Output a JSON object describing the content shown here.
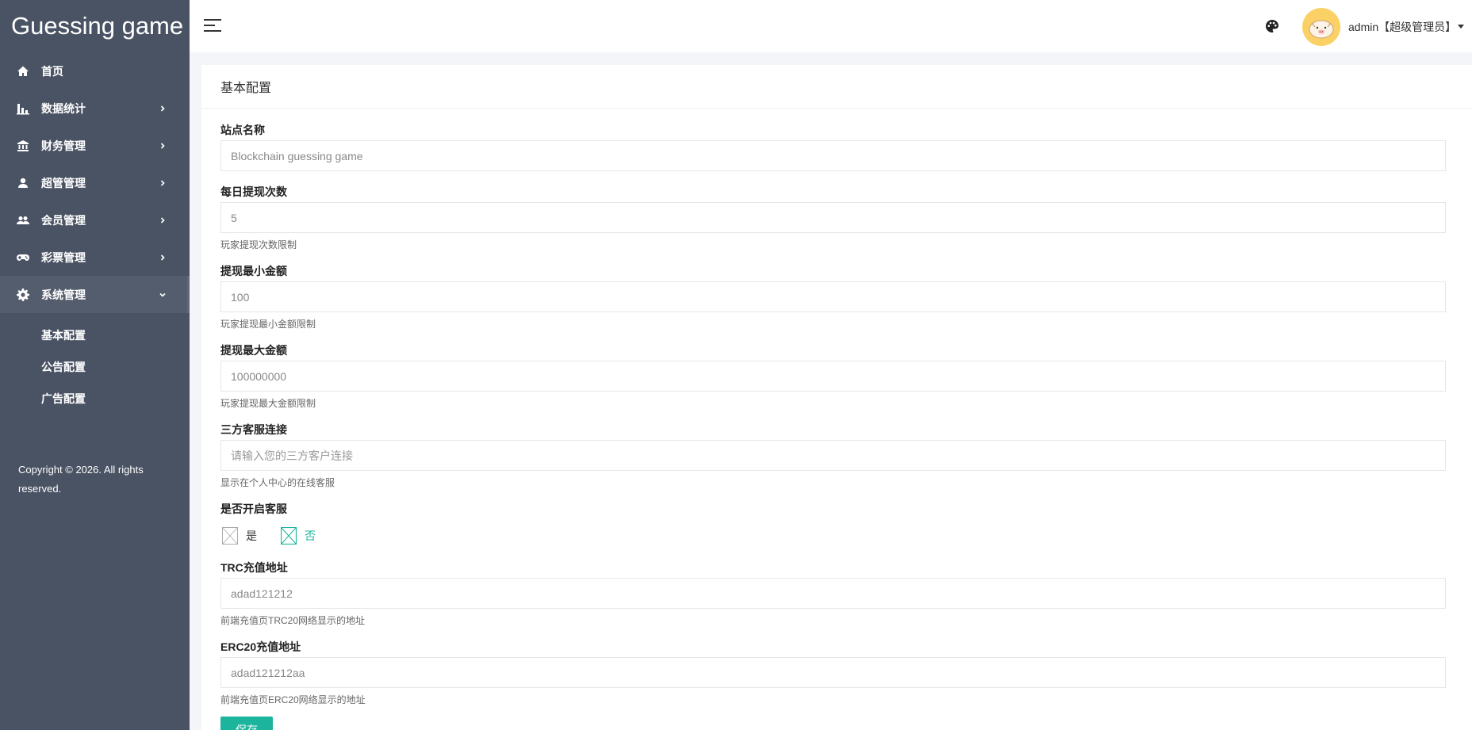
{
  "app": {
    "brand": "Guessing game"
  },
  "sidebar": {
    "items": [
      {
        "label": "首页",
        "icon": "home-icon"
      },
      {
        "label": "数据统计",
        "icon": "bar-chart-icon"
      },
      {
        "label": "财务管理",
        "icon": "bank-icon"
      },
      {
        "label": "超管管理",
        "icon": "user-icon"
      },
      {
        "label": "会员管理",
        "icon": "group-icon"
      },
      {
        "label": "彩票管理",
        "icon": "gamepad-icon"
      },
      {
        "label": "系统管理",
        "icon": "gear-icon"
      }
    ],
    "subitems": [
      {
        "label": "基本配置"
      },
      {
        "label": "公告配置"
      },
      {
        "label": "广告配置"
      }
    ],
    "copyright": "Copyright © 2026. All rights reserved."
  },
  "header": {
    "user_name": "admin【超级管理员】",
    "icons": [
      "menu-icon",
      "palette-icon",
      "avatar"
    ]
  },
  "page": {
    "title": "基本配置"
  },
  "form": {
    "site_name": {
      "label": "站点名称",
      "value": "Blockchain guessing game"
    },
    "daily_withdraw": {
      "label": "每日提现次数",
      "value": "5",
      "help": "玩家提现次数限制"
    },
    "min_withdraw": {
      "label": "提现最小金额",
      "value": "100",
      "help": "玩家提现最小金额限制"
    },
    "max_withdraw": {
      "label": "提现最大金额",
      "value": "100000000",
      "help": "玩家提现最大金额限制"
    },
    "third_party_cs": {
      "label": "三方客服连接",
      "placeholder": "请输入您的三方客户连接",
      "help": "显示在个人中心的在线客服"
    },
    "cs_enabled": {
      "label": "是否开启客服",
      "options": [
        "是",
        "否"
      ],
      "selected": "否"
    },
    "trc_address": {
      "label": "TRC充值地址",
      "value": "adad121212",
      "help": "前端充值页TRC20网络显示的地址"
    },
    "erc20_address": {
      "label": "ERC20充值地址",
      "value": "adad121212aa",
      "help": "前端充值页ERC20网络显示的地址"
    },
    "save_label": "保存"
  },
  "colors": {
    "sidebar_bg": "#4a5364",
    "accent": "#1cb49c",
    "page_bg": "#f4f5f9"
  }
}
